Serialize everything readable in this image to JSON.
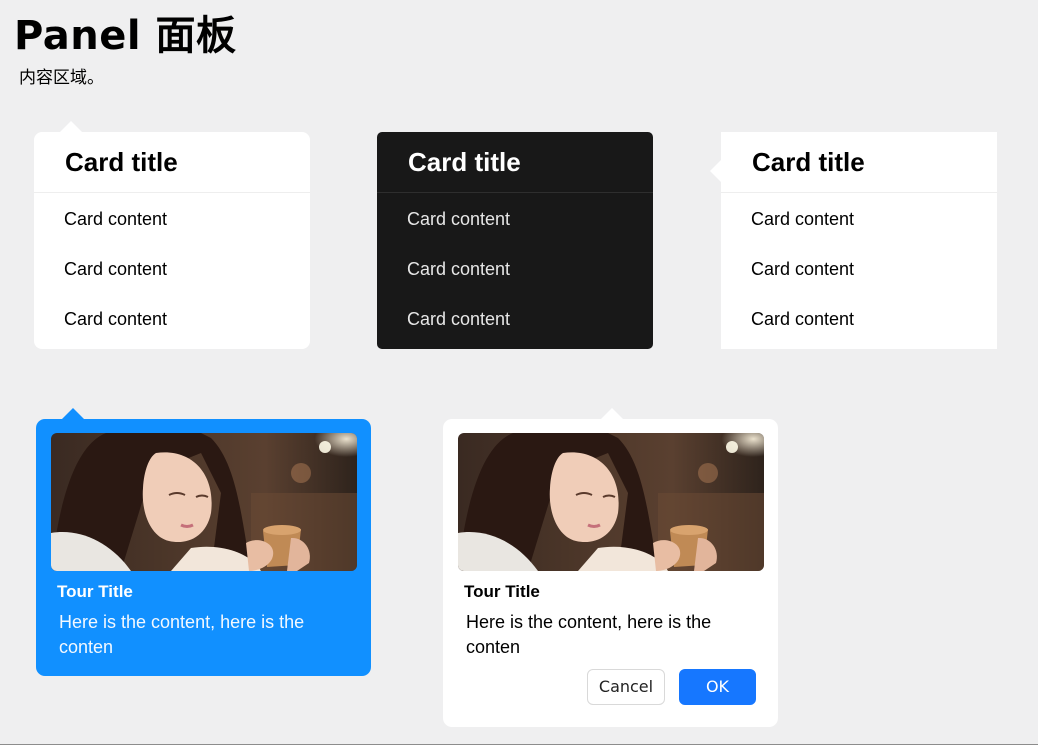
{
  "header": {
    "title": "Panel 面板",
    "subtitle": "内容区域。"
  },
  "cards": [
    {
      "title": "Card title",
      "rows": [
        "Card content",
        "Card content",
        "Card content"
      ],
      "theme": "light"
    },
    {
      "title": "Card title",
      "rows": [
        "Card content",
        "Card content",
        "Card content"
      ],
      "theme": "dark"
    },
    {
      "title": "Card title",
      "rows": [
        "Card content",
        "Card content",
        "Card content"
      ],
      "theme": "light"
    }
  ],
  "tours": [
    {
      "title": "Tour Title",
      "content": "Here is the content, here is the conten",
      "background": "#1190ff"
    },
    {
      "title": "Tour Title",
      "content": "Here is the content, here is the conten",
      "cancel_label": "Cancel",
      "ok_label": "OK",
      "background": "#ffffff"
    }
  ],
  "colors": {
    "primary": "#1677ff",
    "tour_primary_bg": "#1190ff",
    "dark_card_bg": "#181818",
    "page_bg": "#efeff0"
  }
}
